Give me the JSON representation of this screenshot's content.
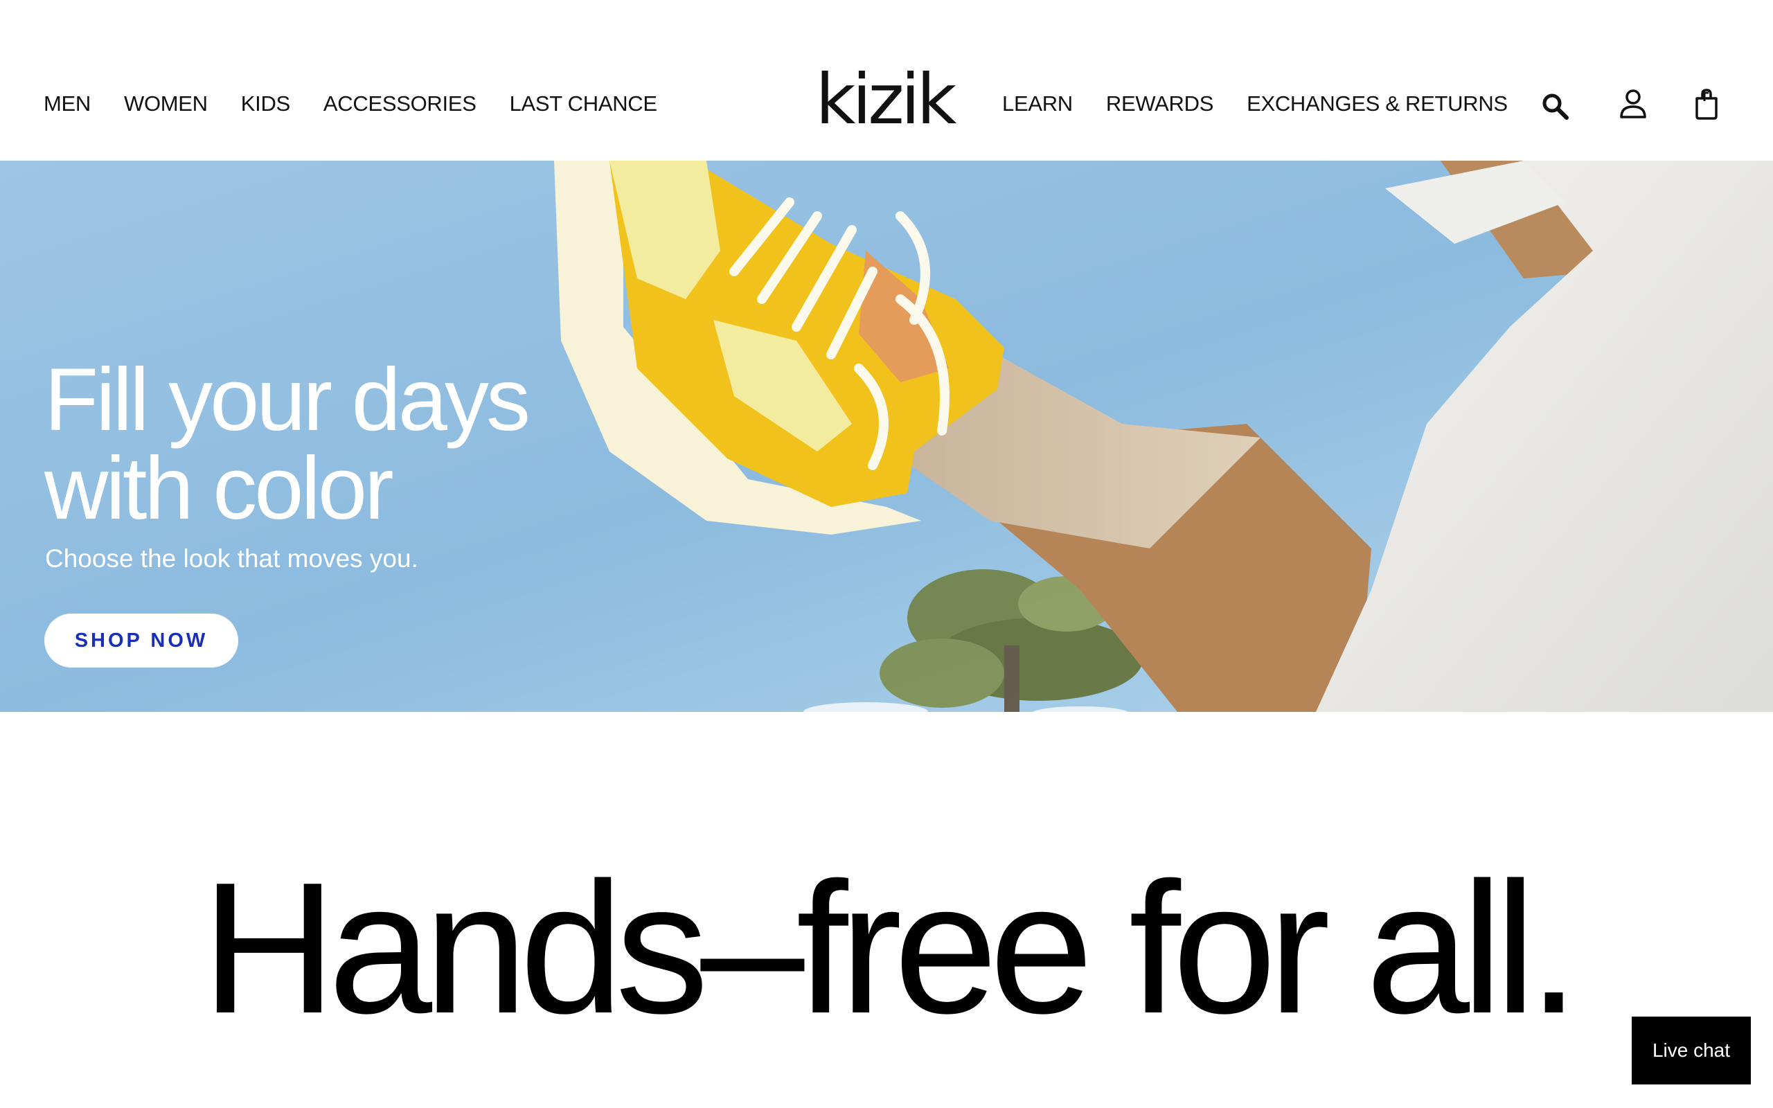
{
  "header": {
    "logo": "kizik",
    "nav_left": [
      "MEN",
      "WOMEN",
      "KIDS",
      "ACCESSORIES",
      "LAST CHANCE"
    ],
    "nav_right": [
      "LEARN",
      "REWARDS",
      "EXCHANGES & RETURNS"
    ],
    "icons": [
      "search-icon",
      "account-icon",
      "cart-icon"
    ]
  },
  "hero": {
    "title_line1": "Fill your days",
    "title_line2": "with color",
    "subtitle": "Choose the look that moves you.",
    "cta": "SHOP NOW",
    "sky_color": "#8fbde0",
    "shoe_color": "#f1c21b"
  },
  "tagline": "Hands–free for all.",
  "live_chat": "Live chat",
  "colors": {
    "cta_text": "#1a2fb8",
    "text": "#000000"
  }
}
